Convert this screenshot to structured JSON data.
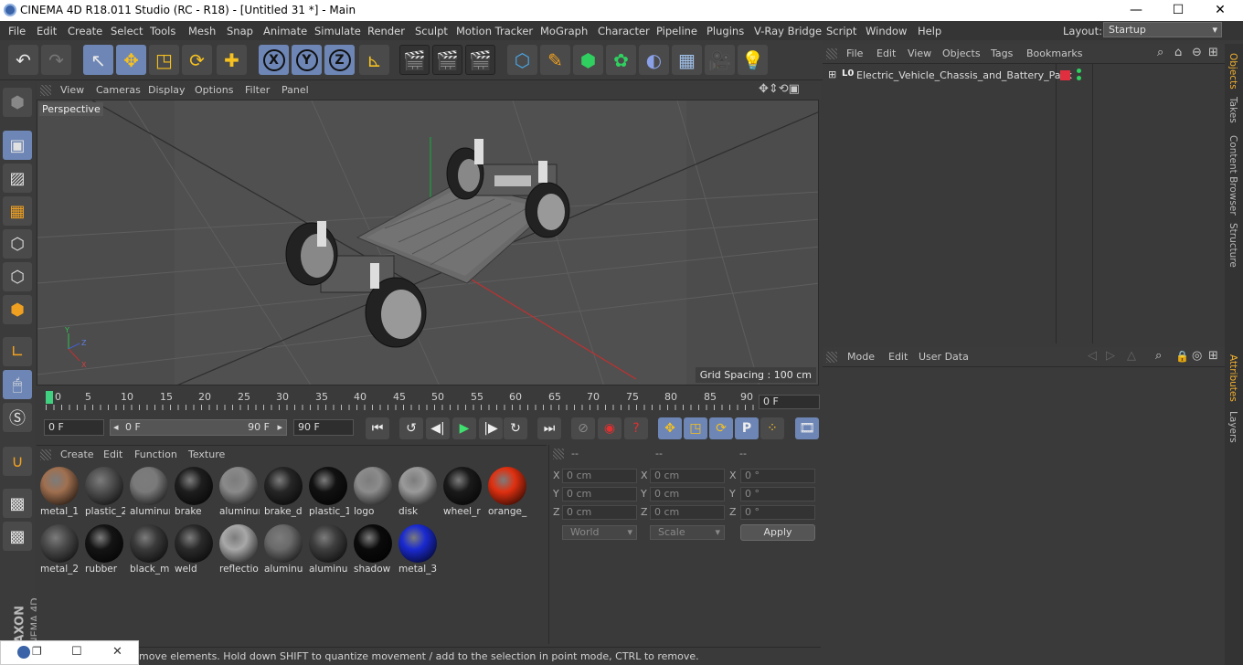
{
  "window": {
    "title": "CINEMA 4D R18.011 Studio (RC - R18) - [Untitled 31 *] - Main",
    "min": "—",
    "max": "☐",
    "close": "✕"
  },
  "menu": [
    "File",
    "Edit",
    "Create",
    "Select",
    "Tools",
    "Mesh",
    "Snap",
    "Animate",
    "Simulate",
    "Render",
    "Sculpt",
    "Motion Tracker",
    "MoGraph",
    "Character",
    "Pipeline",
    "Plugins",
    "V-Ray Bridge",
    "Script",
    "Window",
    "Help"
  ],
  "layout": {
    "label": "Layout:",
    "value": "Startup"
  },
  "toolbar": {
    "undo_icon": "↶",
    "redo_icon": "↷",
    "select_icon": "↖",
    "move_icon": "✥",
    "scale_icon": "◳",
    "rotate_icon": "⟳",
    "create_icon": "✚",
    "x_axis": "X",
    "y_axis": "Y",
    "z_axis": "Z",
    "coord_icon": "⊾",
    "render_view": "🎬",
    "render_pv": "🎬",
    "render_settings": "🎬",
    "cube_icon": "⬡",
    "pen_icon": "✎",
    "subdiv_icon": "⬢",
    "cloner_icon": "✿",
    "deformer_icon": "◐",
    "floor_icon": "▦",
    "camera_icon": "🎥",
    "light_icon": "💡"
  },
  "viewport": {
    "menu": [
      "View",
      "Cameras",
      "Display",
      "Options",
      "Filter",
      "Panel"
    ],
    "label": "Perspective",
    "grid_spacing": "Grid Spacing : 100 cm",
    "nav_icons": "✥⇕⟲▣"
  },
  "timeline": {
    "ticks": [
      "0",
      "5",
      "10",
      "15",
      "20",
      "25",
      "30",
      "35",
      "40",
      "45",
      "50",
      "55",
      "60",
      "65",
      "70",
      "75",
      "80",
      "85",
      "90"
    ],
    "current_frame_field": "0 F"
  },
  "playbar": {
    "start_field": "0 F",
    "range_start": "0 F",
    "range_end": "90 F",
    "end_field": "90 F",
    "range_left_arrow": "◂",
    "range_right_arrow": "▸",
    "buttons": [
      "⏮",
      "↺",
      "◀|",
      "▶",
      "|▶",
      "↻",
      "⏭"
    ],
    "record_buttons": [
      "⊘",
      "◉",
      "?"
    ],
    "key_buttons": [
      "✥",
      "◳",
      "⟳",
      "P",
      "⁘"
    ],
    "timeline_button": "🎞"
  },
  "materials": {
    "menu": [
      "Create",
      "Edit",
      "Function",
      "Texture"
    ],
    "items": [
      {
        "name": "metal_1",
        "color": "#a07050"
      },
      {
        "name": "plastic_2",
        "color": "#505050"
      },
      {
        "name": "aluminum",
        "color": "#7a7a7a"
      },
      {
        "name": "brake",
        "color": "#1e1e1e"
      },
      {
        "name": "aluminum",
        "color": "#8a8a8a"
      },
      {
        "name": "brake_d",
        "color": "#262626"
      },
      {
        "name": "plastic_1",
        "color": "#111111"
      },
      {
        "name": "logo",
        "color": "#8c8c8c"
      },
      {
        "name": "disk",
        "color": "#9a9a9a"
      },
      {
        "name": "wheel_r",
        "color": "#1a1a1a"
      },
      {
        "name": "orange_",
        "color": "#e03010"
      },
      {
        "name": "metal_2",
        "color": "#4a4a4a"
      },
      {
        "name": "rubber",
        "color": "#141414"
      },
      {
        "name": "black_m",
        "color": "#3a3a3a"
      },
      {
        "name": "weld",
        "color": "#2a2a2a"
      },
      {
        "name": "reflectio",
        "color": "#a8a8a8"
      },
      {
        "name": "aluminu",
        "color": "#6a6a6a"
      },
      {
        "name": "aluminu",
        "color": "#3e3e3e"
      },
      {
        "name": "shadow",
        "color": "#0a0a0a"
      },
      {
        "name": "metal_3",
        "color": "#1a2ad0"
      }
    ]
  },
  "coords": {
    "headers": [
      "--",
      "--",
      "--"
    ],
    "rows": [
      {
        "a": "X",
        "v1": "0 cm",
        "b": "X",
        "v2": "0 cm",
        "c": "X",
        "v3": "0 °"
      },
      {
        "a": "Y",
        "v1": "0 cm",
        "b": "Y",
        "v2": "0 cm",
        "c": "Y",
        "v3": "0 °"
      },
      {
        "a": "Z",
        "v1": "0 cm",
        "b": "Z",
        "v2": "0 cm",
        "c": "Z",
        "v3": "0 °"
      }
    ],
    "world": "World",
    "scale": "Scale",
    "apply": "Apply"
  },
  "objects": {
    "menu": [
      "File",
      "Edit",
      "View",
      "Objects",
      "Tags",
      "Bookmarks"
    ],
    "item": "Electric_Vehicle_Chassis_and_Battery_Pack",
    "layer_icon": "L0",
    "expand_icon": "⊞"
  },
  "attributes": {
    "menu": [
      "Mode",
      "Edit",
      "User Data"
    ]
  },
  "side_tabs": [
    "Objects",
    "Takes",
    "Content Browser",
    "Structure"
  ],
  "side_tabs2": [
    "Attributes",
    "Layers"
  ],
  "status": "move elements. Hold down SHIFT to quantize movement / add to the selection in point mode, CTRL to remove.",
  "maxon": {
    "brand": "MAXON",
    "product": "CINEMA 4D"
  },
  "task": {
    "restore": "❐",
    "max": "☐",
    "close": "✕"
  }
}
